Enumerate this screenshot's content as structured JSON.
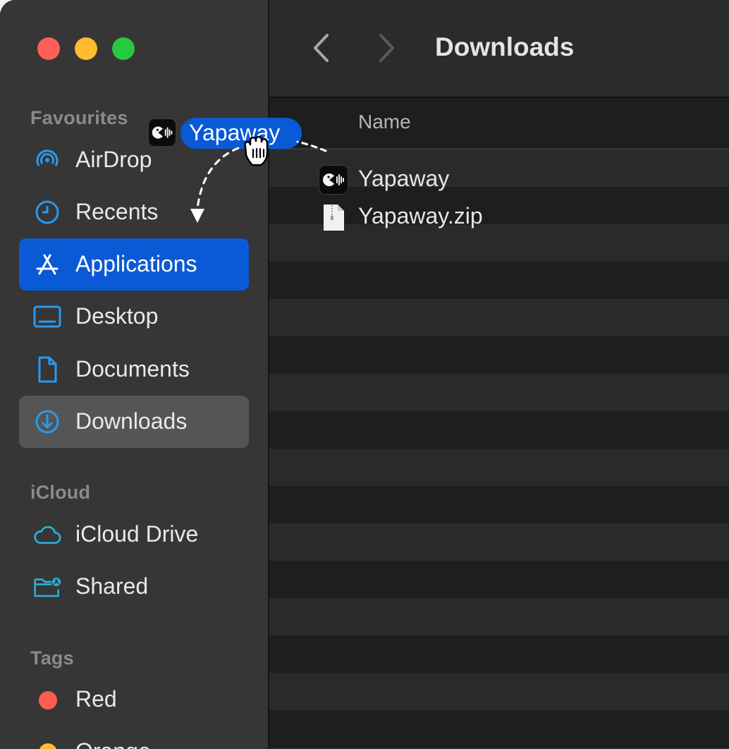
{
  "window": {
    "title": "Downloads",
    "traffic_lights": {
      "close": "#fe5f57",
      "minimize": "#febc2e",
      "zoom": "#28c840"
    }
  },
  "sidebar": {
    "sections": [
      {
        "label": "Favourites"
      },
      {
        "label": "iCloud"
      },
      {
        "label": "Tags"
      }
    ],
    "favourites": [
      {
        "label": "AirDrop",
        "icon": "airdrop-icon"
      },
      {
        "label": "Recents",
        "icon": "clock-icon"
      },
      {
        "label": "Applications",
        "icon": "applications-icon",
        "state": "drop-target"
      },
      {
        "label": "Desktop",
        "icon": "desktop-icon"
      },
      {
        "label": "Documents",
        "icon": "document-icon"
      },
      {
        "label": "Downloads",
        "icon": "download-icon",
        "state": "current"
      }
    ],
    "icloud": [
      {
        "label": "iCloud Drive",
        "icon": "cloud-icon"
      },
      {
        "label": "Shared",
        "icon": "shared-folder-icon"
      }
    ],
    "tags": [
      {
        "label": "Red",
        "color": "#fe5c55"
      },
      {
        "label": "Orange",
        "color": "#febc2e"
      }
    ],
    "accent_color": "#0a5ad6"
  },
  "main": {
    "column_header": "Name",
    "files": [
      {
        "name": "Yapaway",
        "icon": "app-icon"
      },
      {
        "name": "Yapaway.zip",
        "icon": "zip-file-icon"
      }
    ]
  },
  "drag": {
    "label": "Yapaway",
    "icon": "app-icon",
    "cursor": "grab-hand-icon"
  }
}
